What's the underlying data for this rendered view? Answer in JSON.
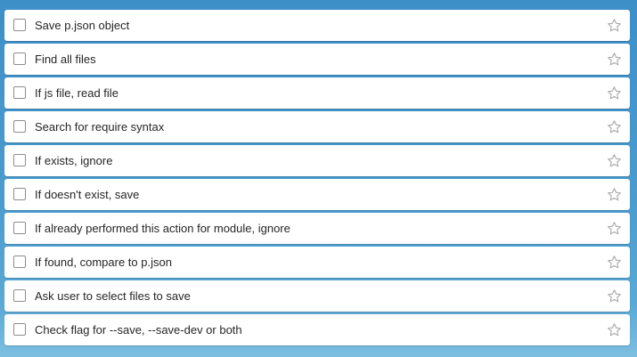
{
  "tasks": [
    {
      "title": "Save p.json object",
      "completed": false,
      "starred": false,
      "star_icon": "star-outline-icon"
    },
    {
      "title": "Find all files",
      "completed": false,
      "starred": false,
      "star_icon": "star-outline-icon"
    },
    {
      "title": "If js file, read file",
      "completed": false,
      "starred": false,
      "star_icon": "star-outline-icon"
    },
    {
      "title": "Search for require syntax",
      "completed": false,
      "starred": false,
      "star_icon": "star-outline-icon"
    },
    {
      "title": "If exists, ignore",
      "completed": false,
      "starred": false,
      "star_icon": "star-outline-icon"
    },
    {
      "title": "If doesn't exist, save",
      "completed": false,
      "starred": false,
      "star_icon": "star-outline-icon"
    },
    {
      "title": "If already performed this action for module, ignore",
      "completed": false,
      "starred": false,
      "star_icon": "star-outline-icon"
    },
    {
      "title": "If found, compare to p.json",
      "completed": false,
      "starred": false,
      "star_icon": "star-outline-icon"
    },
    {
      "title": "Ask user to select files to save",
      "completed": false,
      "starred": false,
      "star_icon": "star-outline-icon"
    },
    {
      "title": "Check flag for --save, --save-dev or both",
      "completed": false,
      "starred": false,
      "star_icon": "star-outline-icon"
    }
  ],
  "colors": {
    "background_top": "#3d8fc8",
    "background_bottom": "#7cbfe0",
    "row_background": "#ffffff",
    "text": "#262626",
    "checkbox_border": "#8e8e8e",
    "star_outline": "#a6a6a6"
  }
}
